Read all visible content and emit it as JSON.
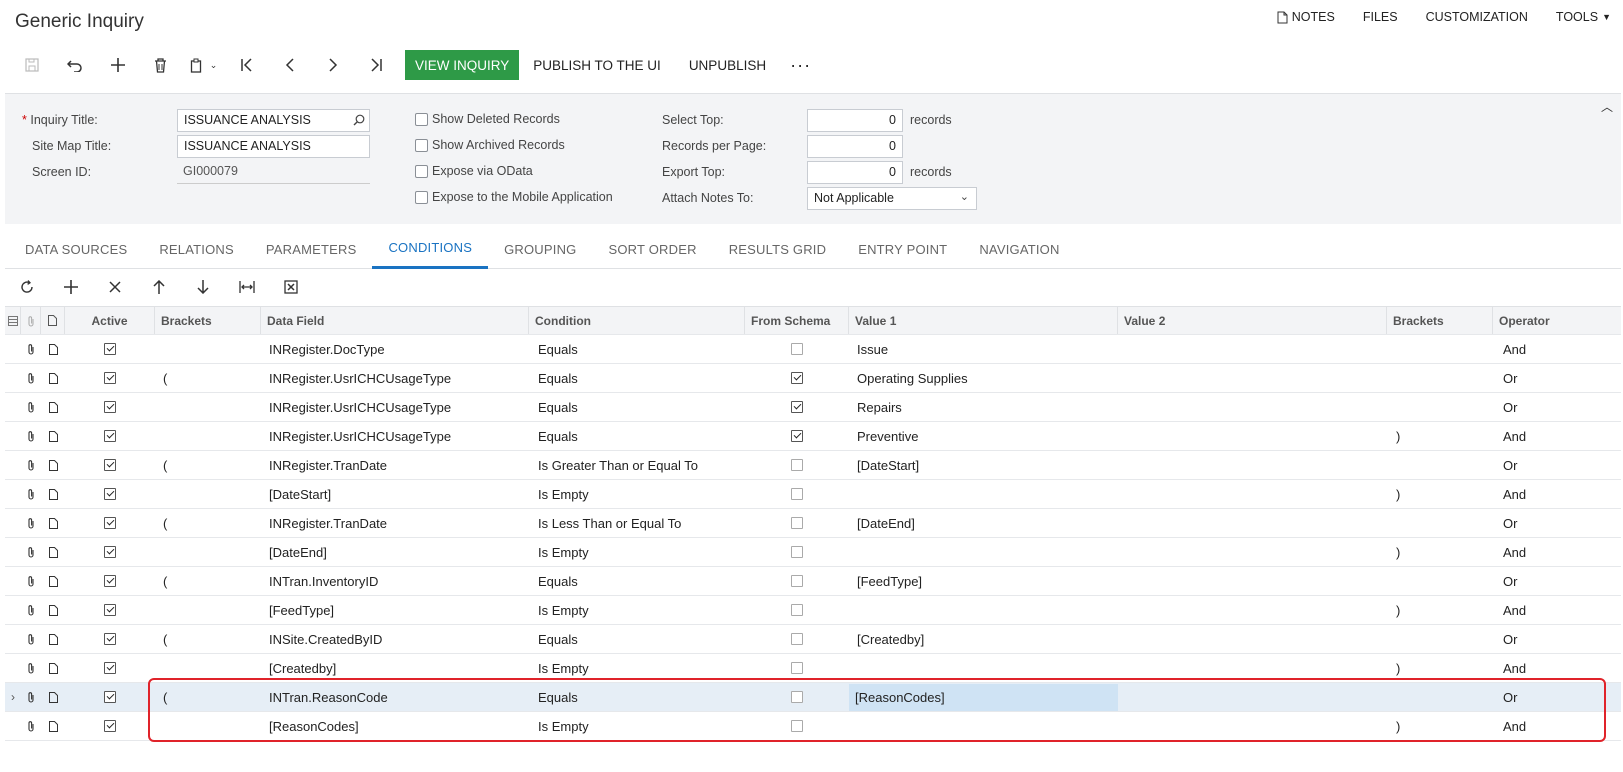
{
  "header": {
    "title": "Generic Inquiry",
    "links": [
      "NOTES",
      "FILES",
      "CUSTOMIZATION",
      "TOOLS"
    ]
  },
  "toolbar": {
    "view_inquiry": "VIEW INQUIRY",
    "publish": "PUBLISH TO THE UI",
    "unpublish": "UNPUBLISH",
    "more": "···"
  },
  "form": {
    "inquiry_title_label": "Inquiry Title:",
    "inquiry_title_value": "ISSUANCE ANALYSIS",
    "site_map_title_label": "Site Map Title:",
    "site_map_title_value": "ISSUANCE ANALYSIS",
    "screen_id_label": "Screen ID:",
    "screen_id_value": "GI000079",
    "show_deleted": "Show Deleted Records",
    "show_archived": "Show Archived Records",
    "expose_odata": "Expose via OData",
    "expose_mobile": "Expose to the Mobile Application",
    "select_top_label": "Select Top:",
    "select_top_value": "0",
    "select_top_unit": "records",
    "records_per_page_label": "Records per Page:",
    "records_per_page_value": "0",
    "export_top_label": "Export Top:",
    "export_top_value": "0",
    "export_top_unit": "records",
    "attach_notes_label": "Attach Notes To:",
    "attach_notes_value": "Not Applicable"
  },
  "tabs": [
    "DATA SOURCES",
    "RELATIONS",
    "PARAMETERS",
    "CONDITIONS",
    "GROUPING",
    "SORT ORDER",
    "RESULTS GRID",
    "ENTRY POINT",
    "NAVIGATION"
  ],
  "grid": {
    "columns": {
      "active": "Active",
      "brackets": "Brackets",
      "data_field": "Data Field",
      "condition": "Condition",
      "from_schema": "From Schema",
      "value1": "Value 1",
      "value2": "Value 2",
      "brackets2": "Brackets",
      "operator": "Operator"
    },
    "rows": [
      {
        "active": true,
        "open": "",
        "field": "INRegister.DocType",
        "condition": "Equals",
        "schema": false,
        "value1": "Issue",
        "value2": "",
        "close": "",
        "op": "And"
      },
      {
        "active": true,
        "open": "(",
        "field": "INRegister.UsrICHCUsageType",
        "condition": "Equals",
        "schema": true,
        "value1": "Operating Supplies",
        "value2": "",
        "close": "",
        "op": "Or"
      },
      {
        "active": true,
        "open": "",
        "field": "INRegister.UsrICHCUsageType",
        "condition": "Equals",
        "schema": true,
        "value1": "Repairs",
        "value2": "",
        "close": "",
        "op": "Or"
      },
      {
        "active": true,
        "open": "",
        "field": "INRegister.UsrICHCUsageType",
        "condition": "Equals",
        "schema": true,
        "value1": "Preventive",
        "value2": "",
        "close": ")",
        "op": "And"
      },
      {
        "active": true,
        "open": "(",
        "field": "INRegister.TranDate",
        "condition": "Is Greater Than or Equal To",
        "schema": false,
        "value1": "[DateStart]",
        "value2": "",
        "close": "",
        "op": "Or"
      },
      {
        "active": true,
        "open": "",
        "field": "[DateStart]",
        "condition": "Is Empty",
        "schema": false,
        "value1": "",
        "value2": "",
        "close": ")",
        "op": "And"
      },
      {
        "active": true,
        "open": "(",
        "field": "INRegister.TranDate",
        "condition": "Is Less Than or Equal To",
        "schema": false,
        "value1": "[DateEnd]",
        "value2": "",
        "close": "",
        "op": "Or"
      },
      {
        "active": true,
        "open": "",
        "field": "[DateEnd]",
        "condition": "Is Empty",
        "schema": false,
        "value1": "",
        "value2": "",
        "close": ")",
        "op": "And"
      },
      {
        "active": true,
        "open": "(",
        "field": "INTran.InventoryID",
        "condition": "Equals",
        "schema": false,
        "value1": "[FeedType]",
        "value2": "",
        "close": "",
        "op": "Or"
      },
      {
        "active": true,
        "open": "",
        "field": "[FeedType]",
        "condition": "Is Empty",
        "schema": false,
        "value1": "",
        "value2": "",
        "close": ")",
        "op": "And"
      },
      {
        "active": true,
        "open": "(",
        "field": "INSite.CreatedByID",
        "condition": "Equals",
        "schema": false,
        "value1": "[Createdby]",
        "value2": "",
        "close": "",
        "op": "Or"
      },
      {
        "active": true,
        "open": "",
        "field": "[Createdby]",
        "condition": "Is Empty",
        "schema": false,
        "value1": "",
        "value2": "",
        "close": ")",
        "op": "And"
      },
      {
        "active": true,
        "open": "(",
        "field": "INTran.ReasonCode",
        "condition": "Equals",
        "schema": false,
        "value1": "[ReasonCodes]",
        "value2": "",
        "close": "",
        "op": "Or"
      },
      {
        "active": true,
        "open": "",
        "field": "[ReasonCodes]",
        "condition": "Is Empty",
        "schema": false,
        "value1": "",
        "value2": "",
        "close": ")",
        "op": "And"
      }
    ]
  },
  "colors": {
    "primary_button": "#2e9a47",
    "active_tab": "#1a73c2",
    "highlight_border": "#e0232a",
    "selected_row": "#e6eef6"
  }
}
